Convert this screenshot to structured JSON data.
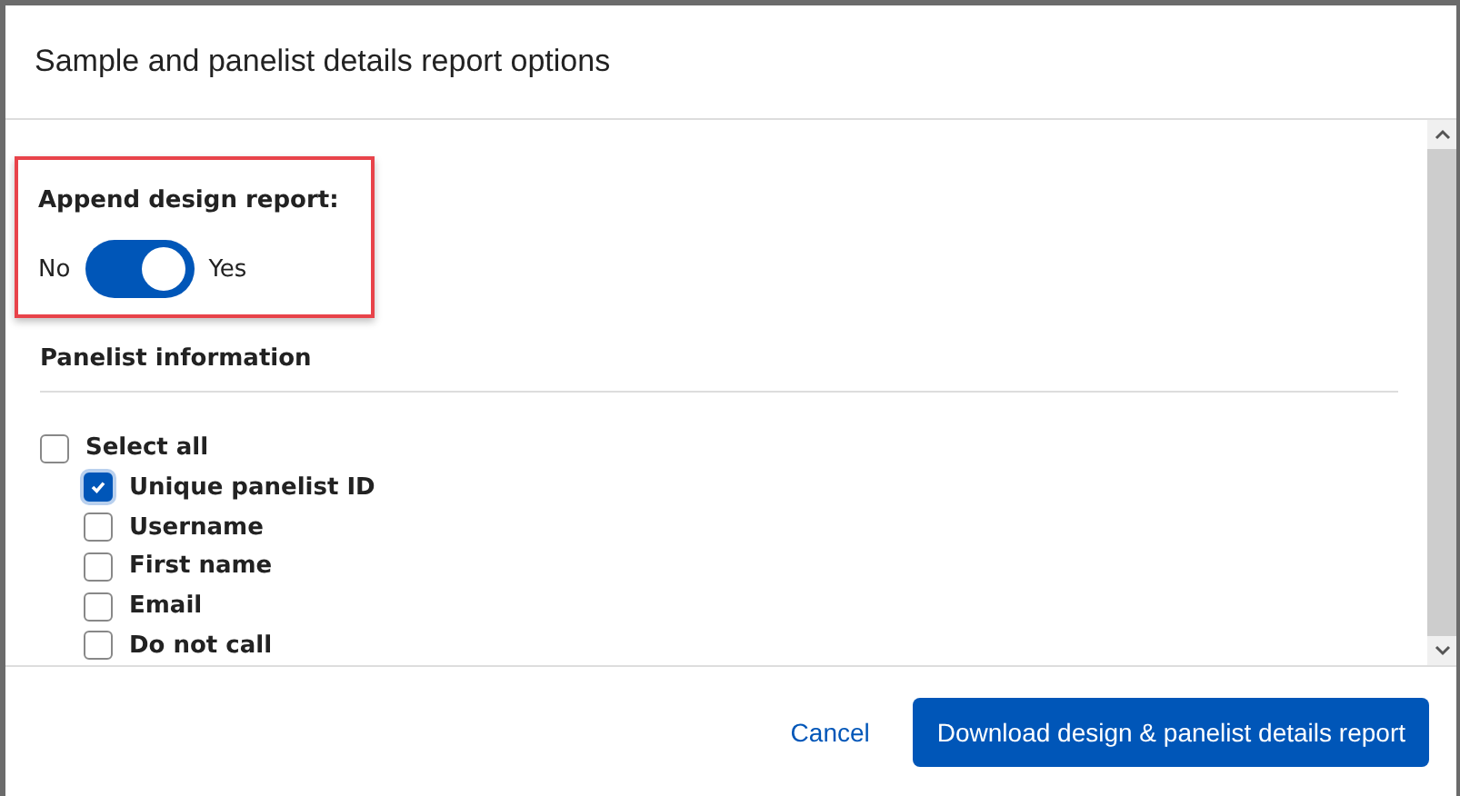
{
  "dialog": {
    "title": "Sample and panelist details report options"
  },
  "append_design_report": {
    "label": "Append design report:",
    "off_label": "No",
    "on_label": "Yes",
    "on": true,
    "highlighted": true
  },
  "panelist_information": {
    "heading": "Panelist information",
    "select_all": {
      "label": "Select all",
      "checked": false
    },
    "options": [
      {
        "label": "Unique panelist ID",
        "checked": true
      },
      {
        "label": "Username",
        "checked": false
      },
      {
        "label": "First name",
        "checked": false
      },
      {
        "label": "Email",
        "checked": false
      },
      {
        "label": "Do not call",
        "checked": false
      }
    ]
  },
  "buttons": {
    "cancel": "Cancel",
    "primary": "Download design & panelist details report"
  }
}
